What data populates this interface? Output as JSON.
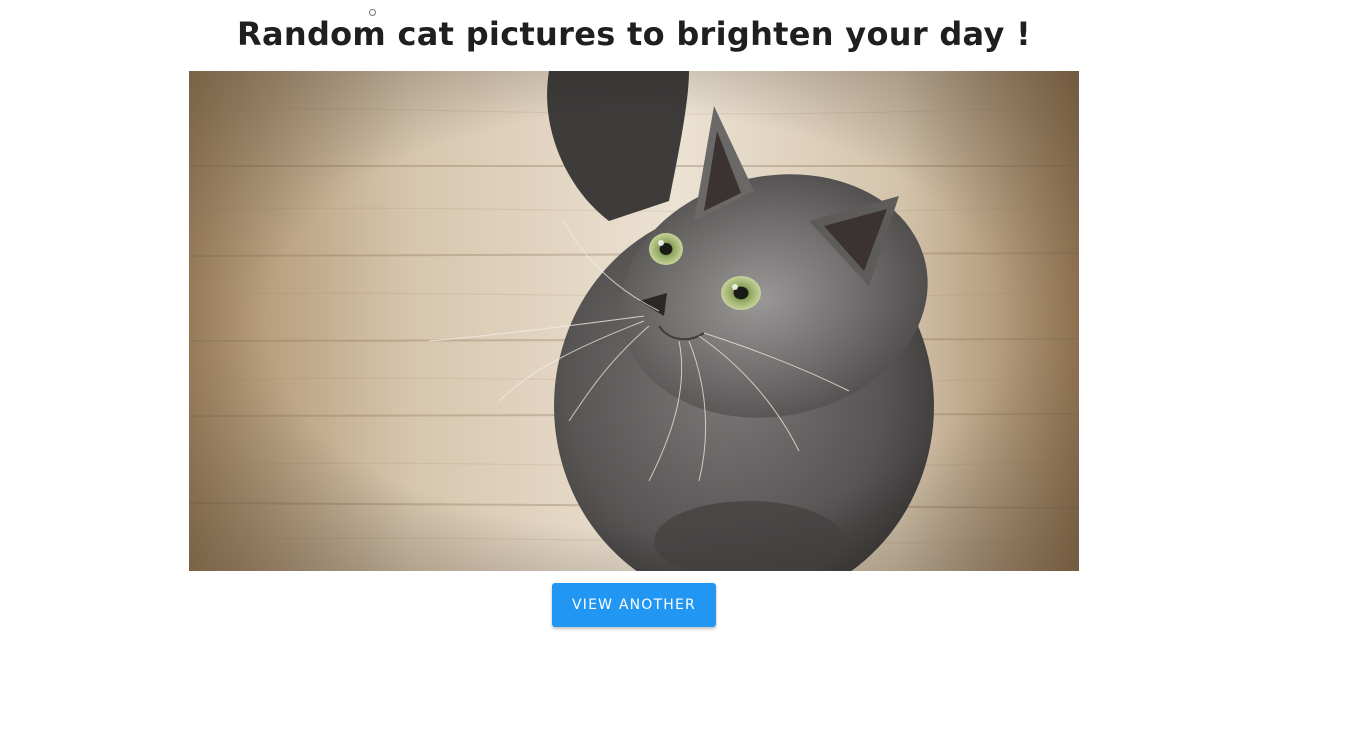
{
  "page": {
    "title": "Random cat pictures to brighten your day !"
  },
  "image": {
    "subject": "gray cat on wooden floor",
    "accent_colors": {
      "floor": "#c9b49a",
      "cat": "#5a5857",
      "eyes": "#9fb36a"
    }
  },
  "actions": {
    "view_another_label": "View another",
    "button_color": "#2196f3"
  }
}
